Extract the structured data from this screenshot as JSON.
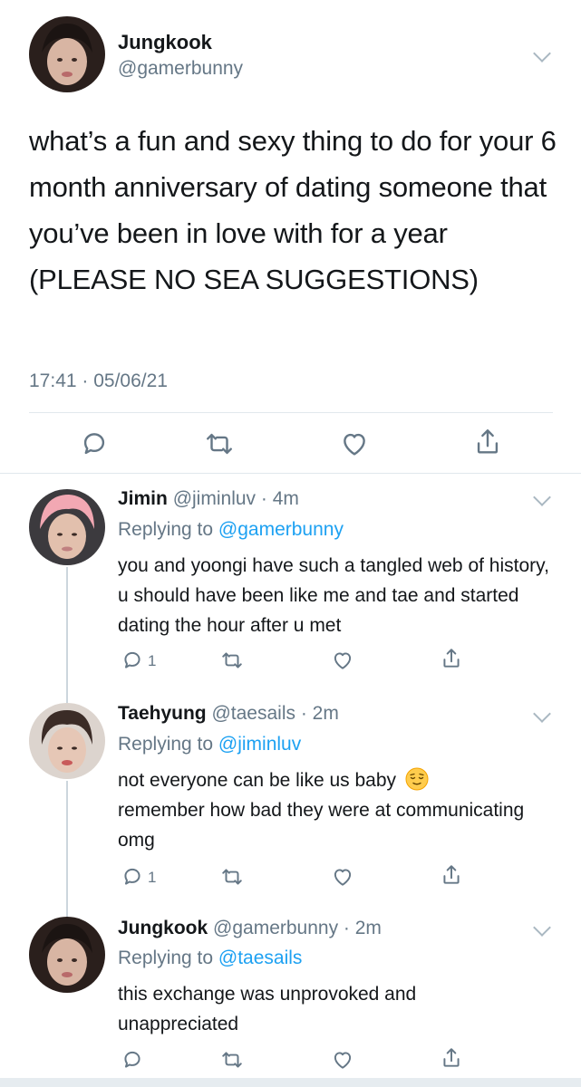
{
  "main_tweet": {
    "display_name": "Jungkook",
    "handle": "@gamerbunny",
    "text": "what’s a fun and sexy thing to do for your 6 month anniversary of dating someone that you’ve been in love with for a year (PLEASE NO SEA SUGGESTIONS)",
    "timestamp": "17:41 · 05/06/21",
    "avatar_icon": "profile-photo"
  },
  "replies": [
    {
      "display_name": "Jimin",
      "handle_time": "@jiminluv · 4m",
      "replying_prefix": "Replying to ",
      "replying_to": "@gamerbunny",
      "text": "you and yoongi have such a tangled web of history, u should have been like me and tae and started dating the hour after u met",
      "reply_count": "1"
    },
    {
      "display_name": "Taehyung",
      "handle_time": "@taesails · 2m",
      "replying_prefix": "Replying to ",
      "replying_to": "@jiminluv",
      "text_before_emoji": "not everyone can be like us baby",
      "text_after_emoji": "remember how bad they were at communicating omg",
      "emoji": "relieved-face-emoji",
      "reply_count": "1"
    },
    {
      "display_name": "Jungkook",
      "handle_time": "@gamerbunny · 2m",
      "replying_prefix": "Replying to ",
      "replying_to": "@taesails",
      "text": "this exchange was unprovoked and unappreciated",
      "reply_count": ""
    }
  ],
  "icons": {
    "reply": "reply-icon",
    "retweet": "retweet-icon",
    "like": "heart-icon",
    "share": "share-icon",
    "more": "chevron-down-icon"
  },
  "colors": {
    "text": "#14171a",
    "secondary": "#657786",
    "link": "#1da1f2",
    "divider": "#e1e8ed"
  }
}
